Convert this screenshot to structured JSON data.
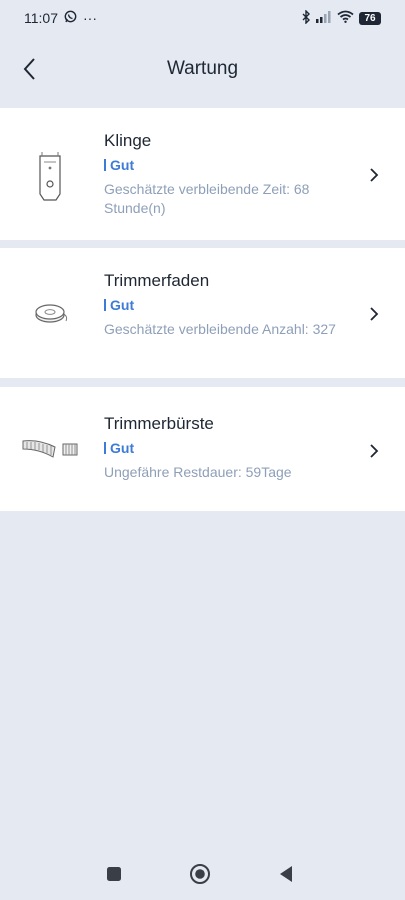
{
  "status_bar": {
    "time": "11:07",
    "more": "···",
    "battery": "76"
  },
  "header": {
    "title": "Wartung"
  },
  "items": [
    {
      "title": "Klinge",
      "status": "Gut",
      "detail": "Geschätzte verbleibende Zeit: 68 Stunde(n)",
      "icon": "blade-icon"
    },
    {
      "title": "Trimmerfaden",
      "status": "Gut",
      "detail": "Geschätzte verbleibende Anzahl: 327",
      "icon": "trimmer-line-spool-icon"
    },
    {
      "title": "Trimmerbürste",
      "status": "Gut",
      "detail": "Ungefähre Restdauer: 59Tage",
      "icon": "trimmer-brush-icon"
    }
  ],
  "colors": {
    "background": "#e4e9f2",
    "status_accent": "#3d7bd6",
    "detail_text": "#8e9fb8"
  },
  "nav": [
    "recents-square-icon",
    "home-circle-icon",
    "back-triangle-icon"
  ]
}
